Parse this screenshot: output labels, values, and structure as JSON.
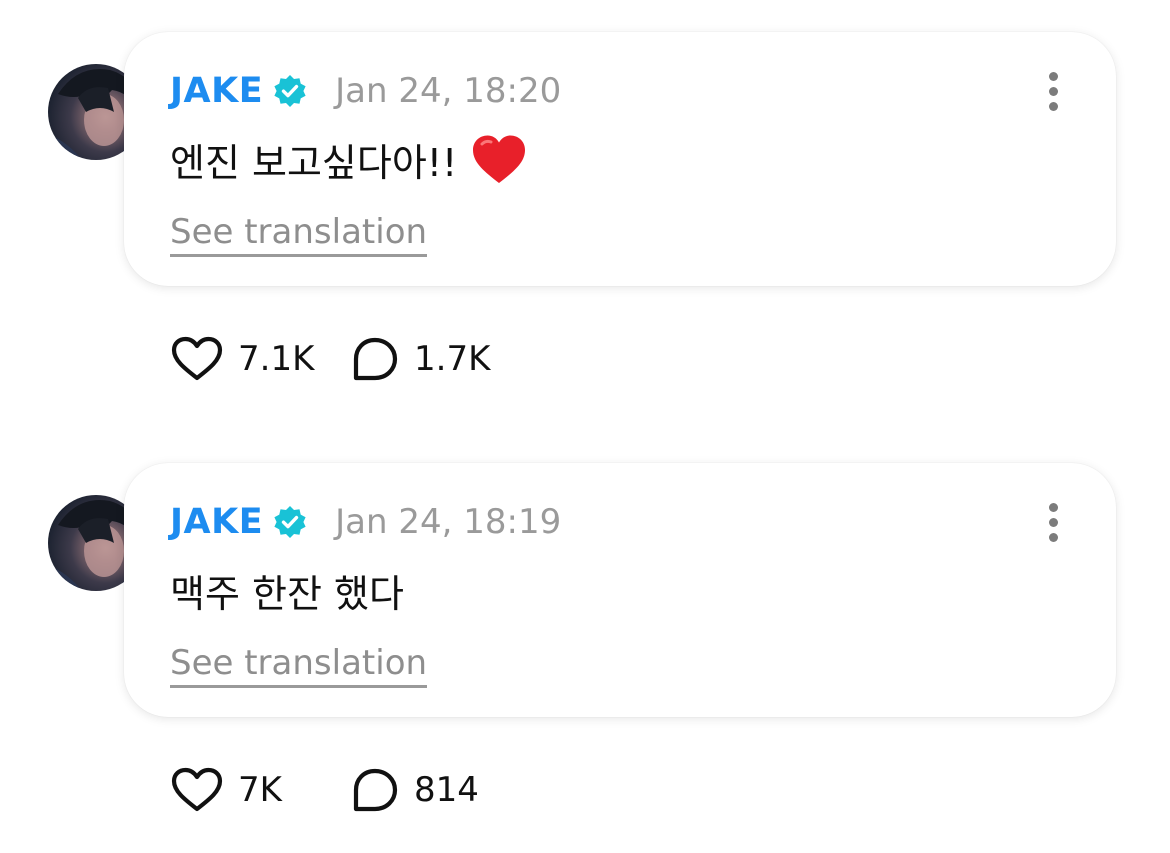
{
  "posts": [
    {
      "author": "JAKE",
      "date": "Jan 24, 18:20",
      "text": "엔진 보고싶다아!!",
      "emoji": "red-heart",
      "translate_label": "See translation",
      "likes": "7.1K",
      "comments": "1.7K"
    },
    {
      "author": "JAKE",
      "date": "Jan 24, 18:19",
      "text": "맥주 한잔 했다",
      "emoji": null,
      "translate_label": "See translation",
      "likes": "7K",
      "comments": "814"
    }
  ],
  "colors": {
    "author": "#1d8cf0",
    "verified": "#19c2d6",
    "muted": "#9a9a9a",
    "heart_emoji": "#e8202a"
  },
  "icons": {
    "verified": "verified-badge-icon",
    "more": "more-vertical-icon",
    "like": "heart-outline-icon",
    "comment": "comment-bubble-icon"
  }
}
